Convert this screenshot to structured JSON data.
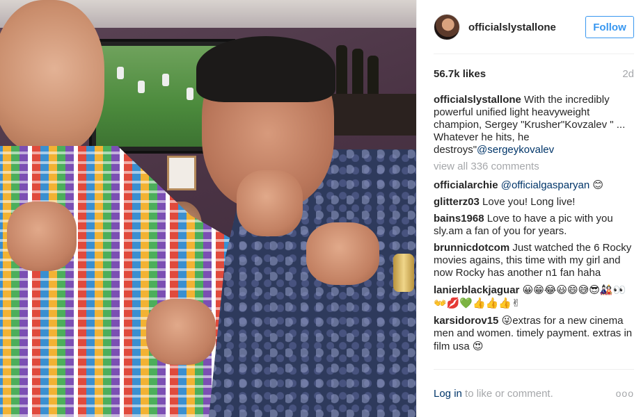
{
  "post": {
    "username": "officialslystallone",
    "follow_label": "Follow",
    "likes": "56.7k likes",
    "age": "2d",
    "caption_user": "officialslystallone",
    "caption_text": "With the incredibly powerful unified light heavyweight champion, Sergey \"Krusher\"Kovzalev \" ... Whatever he hits, he destroys\"",
    "caption_mention": "@sergeykovalev",
    "view_all": "view all 336 comments"
  },
  "comments": [
    {
      "user": "officialarchie",
      "mention": "@officialgasparyan",
      "text": "",
      "emoji": "😊"
    },
    {
      "user": "glitterz03",
      "mention": "",
      "text": "Love you! Long live!",
      "emoji": ""
    },
    {
      "user": "bains1968",
      "mention": "",
      "text": "Love to have a pic with you sly.am a fan of you for years.",
      "emoji": ""
    },
    {
      "user": "brunnicdotcom",
      "mention": "",
      "text": "Just watched the 6 Rocky movies agains, this time with my girl and now Rocky has another n1 fan haha",
      "emoji": ""
    },
    {
      "user": "lanierblackjaguar",
      "mention": "",
      "text": "",
      "emoji": "😀😁😂😃😄😅😎🎎👀👐💋💚👍👍👍✌"
    },
    {
      "user": "karsidorov15",
      "mention": "",
      "text": "extras for a new cinema men and women. timely payment. extras in film usa",
      "emoji_pre": "😜",
      "emoji": "😍"
    }
  ],
  "footer": {
    "login_label": "Log in",
    "like_text": "to like or comment.",
    "more_icon": "more-options-icon",
    "more_glyph": "ooo"
  },
  "colors": {
    "accent": "#3897f0",
    "link": "#003569",
    "muted": "#a5a7aa",
    "text": "#262626"
  }
}
